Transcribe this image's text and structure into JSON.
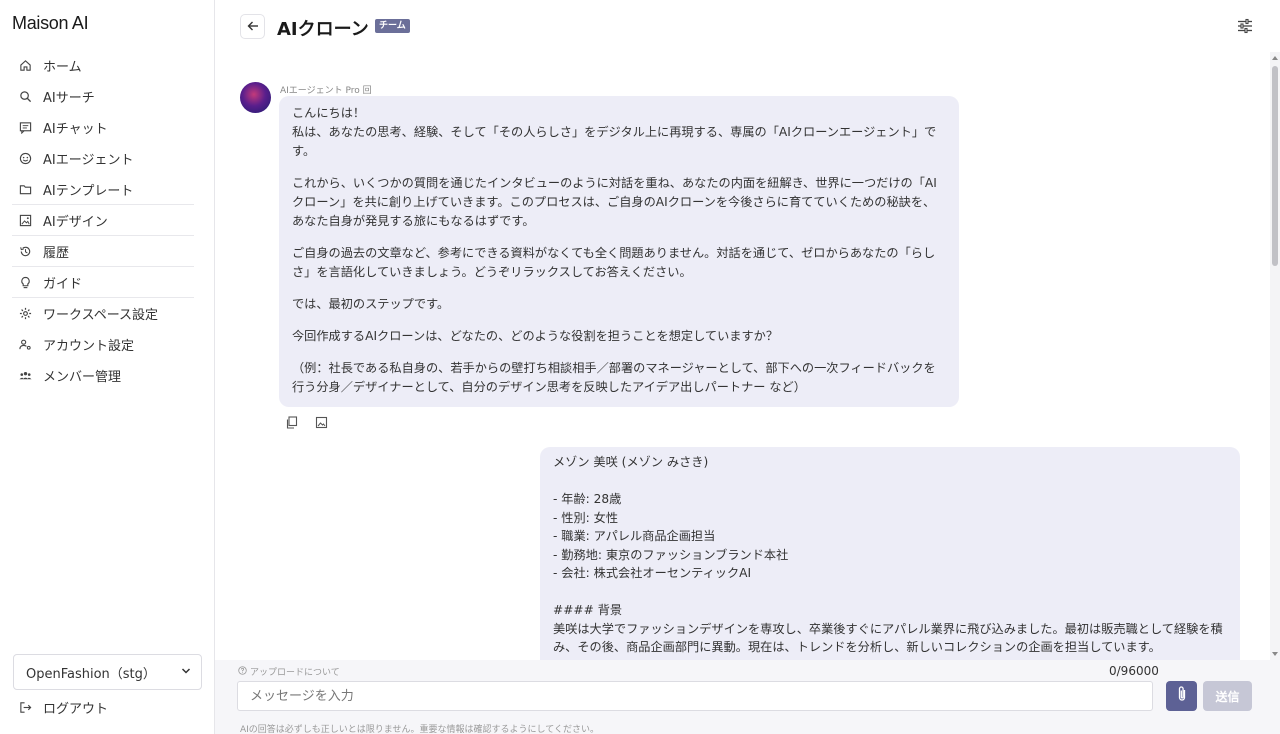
{
  "app": {
    "logo": "Maison AI"
  },
  "sidebar": {
    "items": [
      {
        "label": "ホーム",
        "icon": "home-icon"
      },
      {
        "label": "AIサーチ",
        "icon": "search-icon"
      },
      {
        "label": "AIチャット",
        "icon": "chat-icon"
      },
      {
        "label": "AIエージェント",
        "icon": "agent-icon"
      },
      {
        "label": "AIテンプレート",
        "icon": "folder-icon"
      },
      {
        "label": "AIデザイン",
        "icon": "image-icon"
      },
      {
        "label": "履歴",
        "icon": "history-icon"
      },
      {
        "label": "ガイド",
        "icon": "lightbulb-icon"
      },
      {
        "label": "ワークスペース設定",
        "icon": "gear-icon"
      },
      {
        "label": "アカウント設定",
        "icon": "account-icon"
      },
      {
        "label": "メンバー管理",
        "icon": "members-icon"
      }
    ],
    "workspace": "OpenFashion（stg）",
    "logout": "ログアウト"
  },
  "header": {
    "title": "AIクローン",
    "badge": "チーム"
  },
  "chat": {
    "agent_label": "AIエージェント Pro 回",
    "ai_message": [
      "こんにちは！\n私は、あなたの思考、経験、そして「その人らしさ」をデジタル上に再現する、専属の「AIクローンエージェント」です。",
      "これから、いくつかの質問を通じたインタビューのように対話を重ね、あなたの内面を紐解き、世界に一つだけの「AIクローン」を共に創り上げていきます。このプロセスは、ご自身のAIクローンを今後さらに育てていくための秘訣を、あなた自身が発見する旅にもなるはずです。",
      "ご自身の過去の文章など、参考にできる資料がなくても全く問題ありません。対話を通じて、ゼロからあなたの「らしさ」を言語化していきましょう。どうぞリラックスしてお答えください。",
      "では、最初のステップです。",
      "今回作成するAIクローンは、どなたの、どのような役割を担うことを想定していますか？",
      "（例：社長である私自身の、若手からの壁打ち相談相手／部署のマネージャーとして、部下への一次フィードバックを行う分身／デザイナーとして、自分のデザイン思考を反映したアイデア出しパートナー など）"
    ],
    "user_message": [
      "メゾン 美咲 (メゾン みさき)",
      "",
      "- 年齢: 28歳",
      "- 性別: 女性",
      "- 職業: アパレル商品企画担当",
      "- 勤務地: 東京のファッションブランド本社",
      "- 会社: 株式会社オーセンティックAI",
      "",
      "#### 背景",
      "美咲は大学でファッションデザインを専攻し、卒業後すぐにアパレル業界に飛び込みました。最初は販売職として経験を積み、その後、商品企画部門に異動。現在は、トレンドを分析し、新しいコレクションの企画を担当しています。"
    ]
  },
  "composer": {
    "upload_about": "アップロードについて",
    "char_count": "0/96000",
    "placeholder": "メッセージを入力",
    "value": "",
    "send_label": "送信",
    "disclaimer": "AIの回答は必ずしも正しいとは限りません。重要な情報は確認するようにしてください。"
  },
  "colors": {
    "accent": "#5d6195",
    "bubble": "#ededf7",
    "badge": "#6b6f99",
    "send_disabled": "#c6c7d6"
  }
}
